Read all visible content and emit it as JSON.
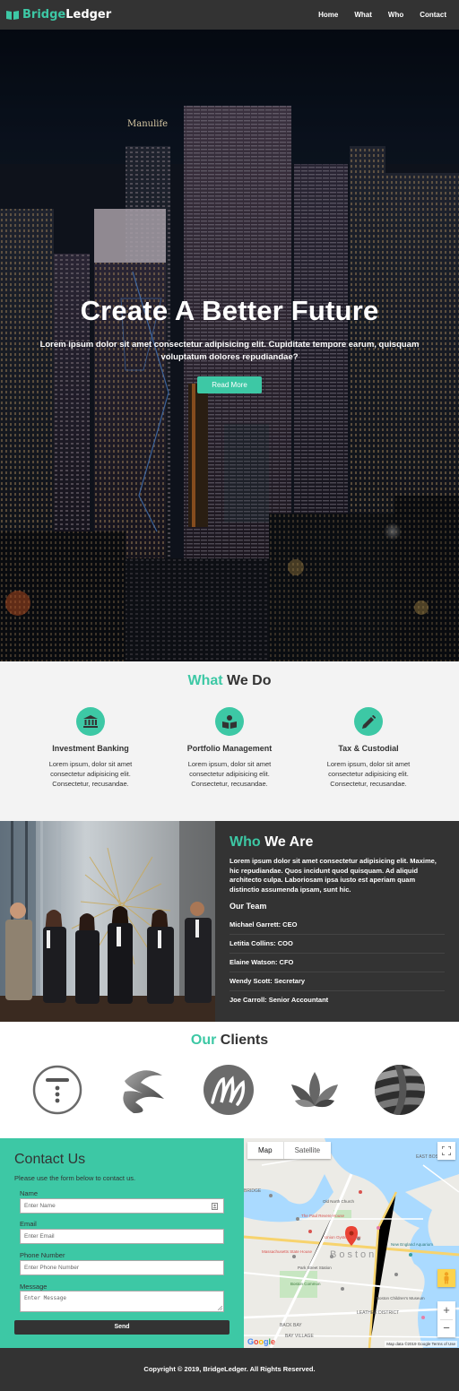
{
  "nav": {
    "brand_first": "Bridge",
    "brand_second": "Ledger",
    "links": [
      "Home",
      "What",
      "Who",
      "Contact"
    ]
  },
  "hero": {
    "title": "Create A Better Future",
    "text": "Lorem ipsum dolor sit amet consectetur adipisicing elit. Cupiditate tempore earum, quisquam voluptatum dolores repudiandae?",
    "button": "Read More",
    "sign_text": "Manulife"
  },
  "what": {
    "title_accent": "What",
    "title_rest": " We Do",
    "services": [
      {
        "icon": "bank-icon",
        "title": "Investment Banking",
        "text": "Lorem ipsum, dolor sit amet consectetur adipisicing elit. Consectetur, recusandae."
      },
      {
        "icon": "book-reader-icon",
        "title": "Portfolio Management",
        "text": "Lorem ipsum, dolor sit amet consectetur adipisicing elit. Consectetur, recusandae."
      },
      {
        "icon": "pencil-icon",
        "title": "Tax & Custodial",
        "text": "Lorem ipsum, dolor sit amet consectetur adipisicing elit. Consectetur, recusandae."
      }
    ]
  },
  "who": {
    "title_accent": "Who",
    "title_rest": " We Are",
    "text": "Lorem ipsum dolor sit amet consectetur adipisicing elit. Maxime, hic repudiandae. Quos incidunt quod quisquam. Ad aliquid architecto culpa. Laboriosam ipsa iusto est aperiam quam distinctio assumenda ipsam, sunt hic.",
    "team_title": "Our Team",
    "team": [
      "Michael Garrett: CEO",
      "Letitia Collins: COO",
      "Elaine Watson: CFO",
      "Wendy Scott: Secretary",
      "Joe Carroll: Senior Accountant"
    ]
  },
  "clients": {
    "title_accent": "Our",
    "title_rest": " Clients"
  },
  "contact": {
    "title": "Contact Us",
    "subtitle": "Please use the form below to contact us.",
    "name_label": "Name",
    "name_placeholder": "Enter Name",
    "email_label": "Email",
    "email_placeholder": "Enter Email",
    "phone_label": "Phone Number",
    "phone_placeholder": "Enter Phone Number",
    "message_label": "Message",
    "message_placeholder": "Enter Message",
    "send": "Send"
  },
  "map": {
    "map_tab": "Map",
    "satellite_tab": "Satellite",
    "city_label": "Boston",
    "labels": [
      "EAST BOSTON",
      "BACK BAY",
      "LEATHER DISTRICT",
      "BAY VILLAGE",
      "BRIDGE",
      "Old North Church",
      "Union Oyster House",
      "The Paul Revere House",
      "Park Street Station",
      "Boston Common",
      "Boston Children's Museum",
      "New England Aquarium",
      "Massachusetts State House"
    ],
    "zoom_in": "+",
    "zoom_out": "−",
    "google": "Google",
    "attribution": "Map data ©2019 Google  Terms of Use"
  },
  "footer": {
    "text": "Copyright © 2019, BridgeLedger. All Rights Reserved."
  },
  "colors": {
    "accent": "#3dc8a5",
    "dark": "#333333",
    "light_bg": "#f3f3f3"
  }
}
